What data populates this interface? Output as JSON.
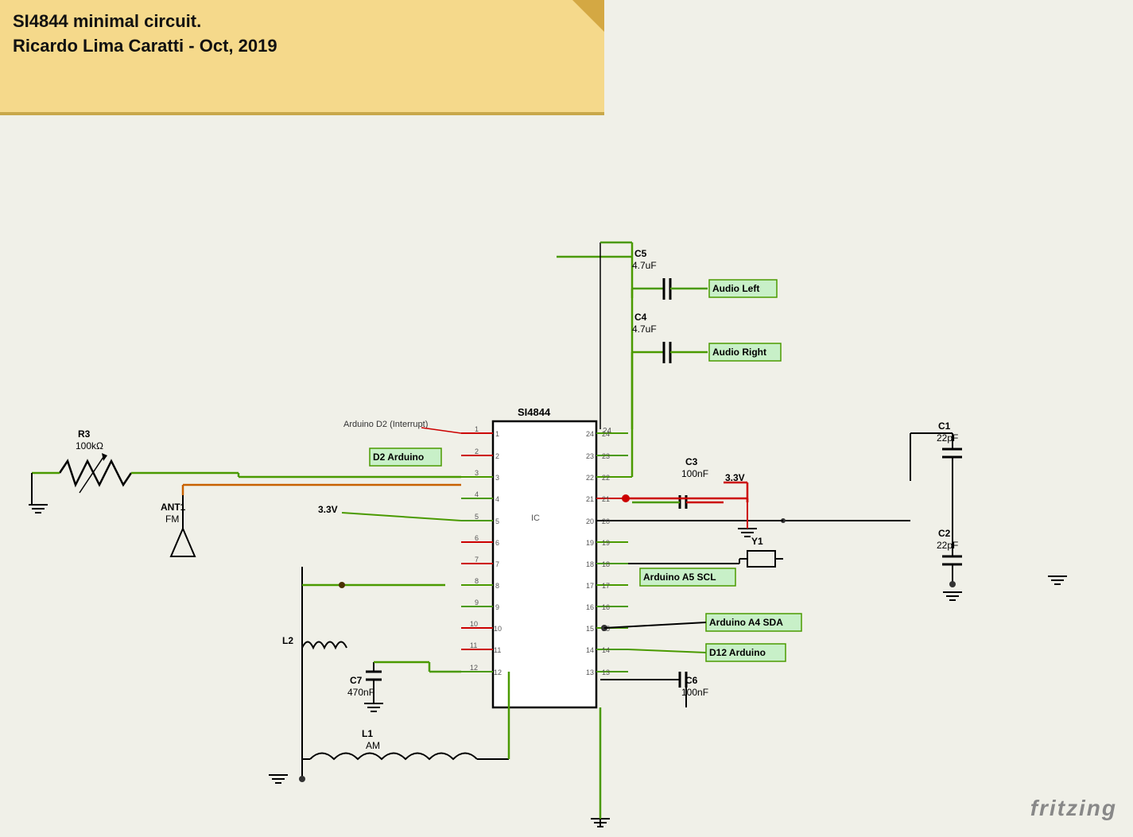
{
  "note": {
    "title_line1": "SI4844 minimal circuit.",
    "title_line2": "Ricardo Lima Caratti - Oct, 2019"
  },
  "fritzing": {
    "label": "fritzing"
  },
  "components": {
    "R3": {
      "name": "R3",
      "value": "100kΩ"
    },
    "ANT1": {
      "name": "ANT1",
      "value": "FM"
    },
    "L2": {
      "name": "L2"
    },
    "C7": {
      "name": "C7",
      "value": "470nF"
    },
    "L1": {
      "name": "L1",
      "value": "AM"
    },
    "IC": {
      "name": "SI4844"
    },
    "C3": {
      "name": "C3",
      "value": "100nF"
    },
    "C6": {
      "name": "C6",
      "value": "100nF"
    },
    "C5": {
      "name": "C5",
      "value": "4.7uF"
    },
    "C4": {
      "name": "C4",
      "value": "4.7uF"
    },
    "C1": {
      "name": "C1",
      "value": "22pF"
    },
    "C2": {
      "name": "C2",
      "value": "22pF"
    },
    "Y1": {
      "name": "Y1"
    },
    "voltage_3v3a": {
      "label": "3.3V"
    },
    "voltage_3v3b": {
      "label": "3.3V"
    },
    "audio_left": {
      "label": "Audio Left"
    },
    "audio_right": {
      "label": "Audio Right"
    },
    "d2_arduino": {
      "label": "D2 Arduino"
    },
    "d12_arduino": {
      "label": "D12 Arduino"
    },
    "arduino_a5_scl": {
      "label": "Arduino A5 SCL"
    },
    "arduino_a4_sda": {
      "label": "Arduino A4 SDA"
    },
    "arduino_d2_interrupt": {
      "label": "Arduino D2 (Interrupt)"
    }
  }
}
